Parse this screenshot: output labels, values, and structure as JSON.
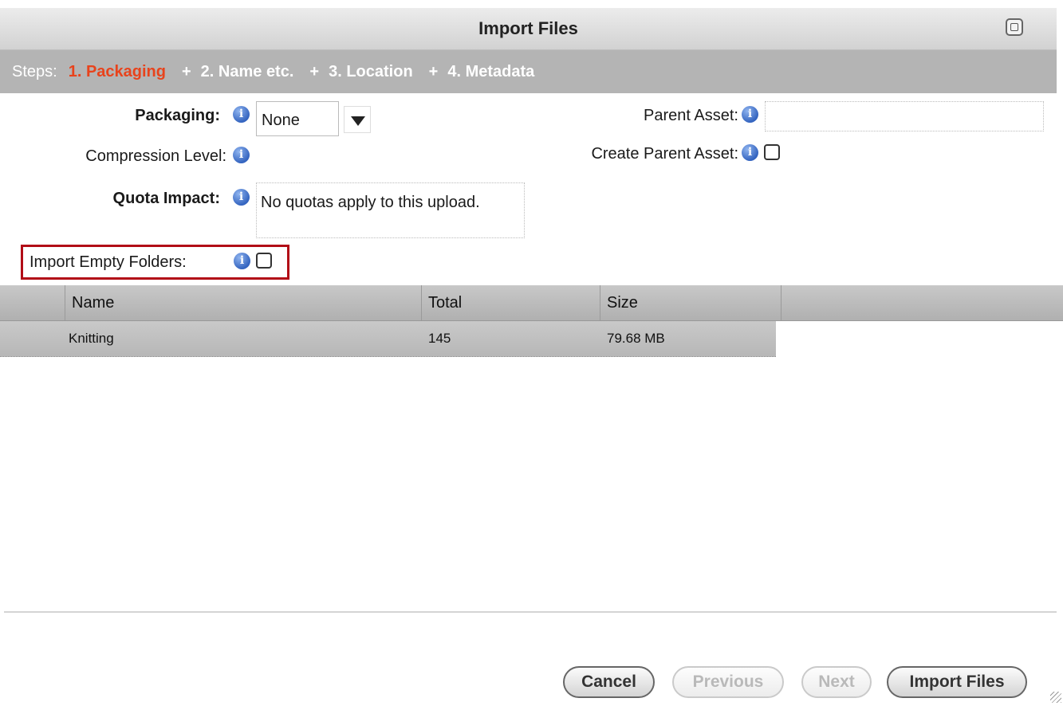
{
  "window": {
    "title": "Import Files"
  },
  "steps": {
    "label": "Steps:",
    "items": [
      "1. Packaging",
      "2. Name etc.",
      "3. Location",
      "4. Metadata"
    ],
    "separator": "+",
    "active_color": "#e8431c"
  },
  "form": {
    "packaging_label": "Packaging:",
    "packaging_value": "None",
    "compression_label": "Compression Level:",
    "quota_label": "Quota Impact:",
    "quota_value": "No quotas apply to this upload.",
    "import_empty_label": "Import Empty Folders:",
    "import_empty_checked": false,
    "parent_asset_label": "Parent Asset:",
    "parent_asset_value": "",
    "create_parent_label": "Create Parent Asset:",
    "create_parent_checked": false,
    "highlight_color": "#b20d17"
  },
  "table": {
    "columns": [
      "Name",
      "Total",
      "Size"
    ],
    "rows": [
      {
        "name": "Knitting",
        "total": "145",
        "size": "79.68 MB"
      }
    ]
  },
  "buttons": {
    "cancel": "Cancel",
    "previous": "Previous",
    "next": "Next",
    "import": "Import Files"
  },
  "icons": [
    "info-icon",
    "dropdown-arrow-icon",
    "window-restore-icon",
    "resize-grip-icon"
  ]
}
